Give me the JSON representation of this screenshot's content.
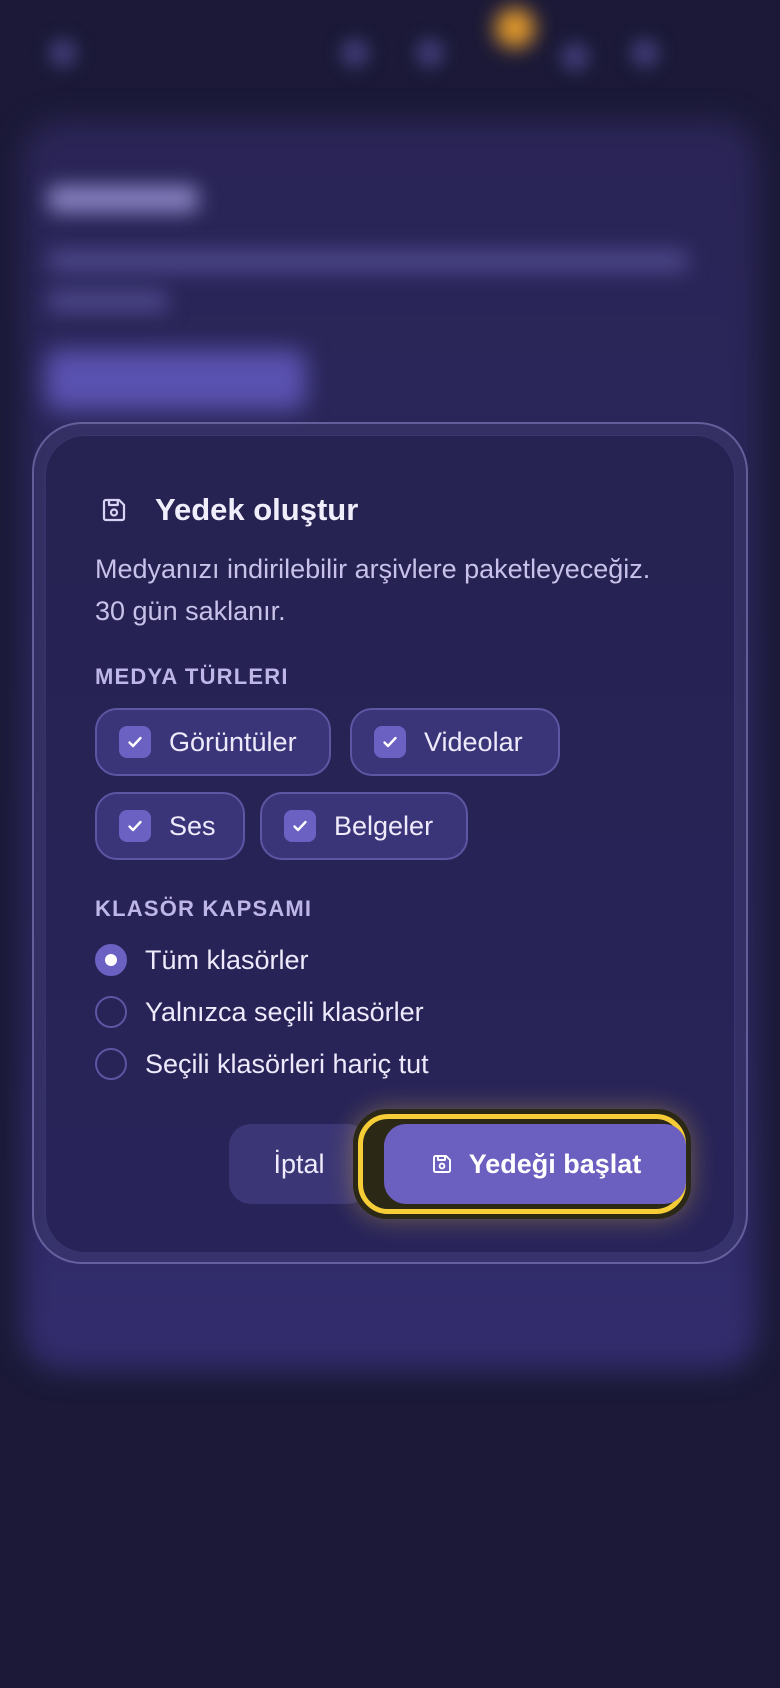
{
  "dialog": {
    "title": "Yedek oluştur",
    "title_icon": "save-icon",
    "description": "Medyanızı indirilebilir arşivlere paketleyeceğiz. 30 gün saklanır.",
    "media_section_label": "MEDYA TÜRLERI",
    "media_types": [
      {
        "label": "Görüntüler",
        "checked": true
      },
      {
        "label": "Videolar",
        "checked": true
      },
      {
        "label": "Ses",
        "checked": true
      },
      {
        "label": "Belgeler",
        "checked": true
      }
    ],
    "folder_section_label": "KLASÖR KAPSAMI",
    "folder_scope": [
      {
        "label": "Tüm klasörler",
        "selected": true
      },
      {
        "label": "Yalnızca seçili klasörler",
        "selected": false
      },
      {
        "label": "Seçili klasörleri hariç tut",
        "selected": false
      }
    ],
    "cancel_label": "İptal",
    "start_label": "Yedeği başlat",
    "start_icon": "save-icon"
  },
  "colors": {
    "background": "#1b1937",
    "dialog": "#262251",
    "accent": "#6b5fbf",
    "focus_ring": "#f6cd37"
  }
}
